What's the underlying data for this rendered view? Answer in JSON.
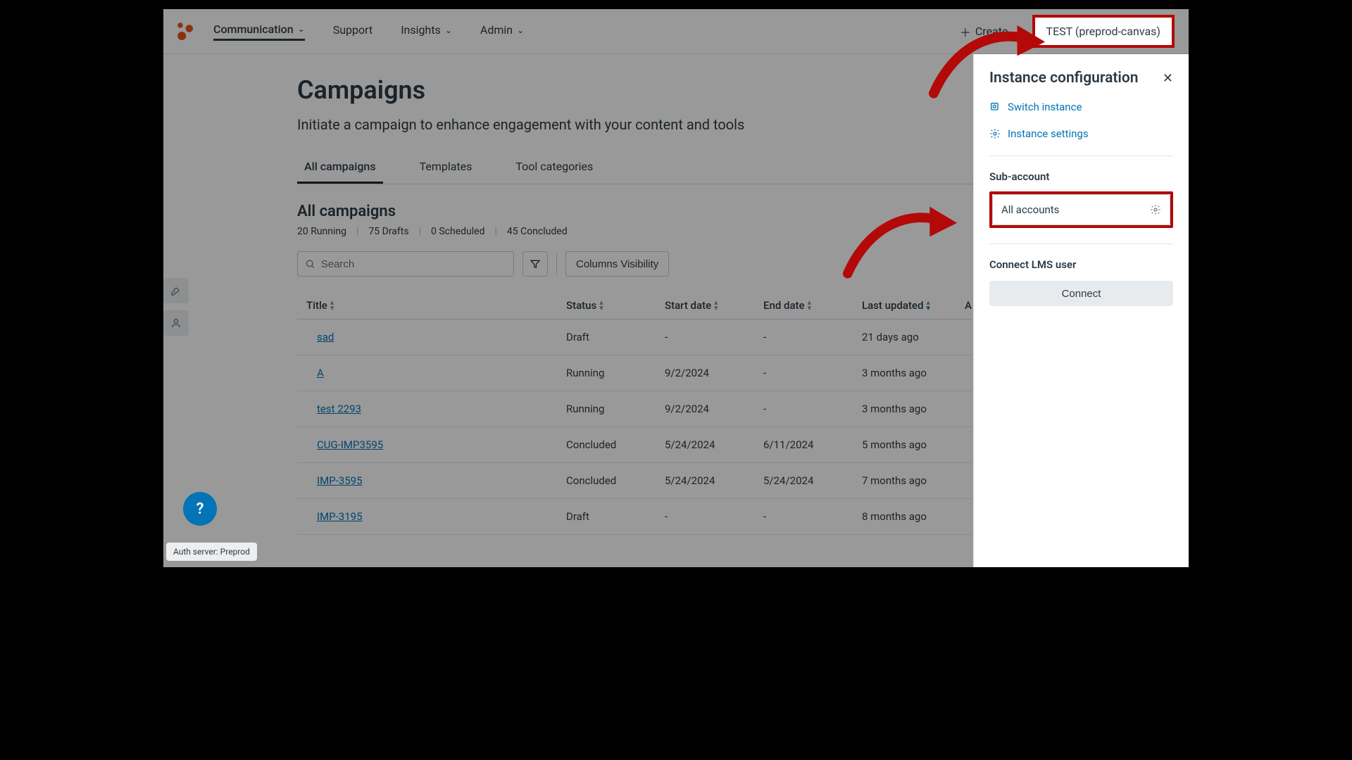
{
  "header": {
    "nav": {
      "communication": "Communication",
      "support": "Support",
      "insights": "Insights",
      "admin": "Admin"
    },
    "create": "Create",
    "instance": "TEST (preprod-canvas)"
  },
  "page": {
    "title": "Campaigns",
    "subtitle": "Initiate a campaign to enhance engagement with your content and tools"
  },
  "tabs": {
    "all": "All campaigns",
    "templates": "Templates",
    "toolcat": "Tool categories"
  },
  "section": {
    "heading": "All campaigns",
    "stats": {
      "running": "20 Running",
      "drafts": "75 Drafts",
      "scheduled": "0 Scheduled",
      "concluded": "45 Concluded"
    }
  },
  "toolbar": {
    "search_placeholder": "Search",
    "columns": "Columns Visibility"
  },
  "columns": {
    "title": "Title",
    "status": "Status",
    "start": "Start date",
    "end": "End date",
    "last": "Last updated",
    "a": "A"
  },
  "rows": [
    {
      "title": "sad",
      "status": "Draft",
      "start": "-",
      "end": "-",
      "last": "21 days ago"
    },
    {
      "title": "A",
      "status": "Running",
      "start": "9/2/2024",
      "end": "-",
      "last": "3 months ago"
    },
    {
      "title": "test 2293",
      "status": "Running",
      "start": "9/2/2024",
      "end": "-",
      "last": "3 months ago"
    },
    {
      "title": "CUG-IMP3595",
      "status": "Concluded",
      "start": "5/24/2024",
      "end": "6/11/2024",
      "last": "5 months ago"
    },
    {
      "title": "IMP-3595",
      "status": "Concluded",
      "start": "5/24/2024",
      "end": "5/24/2024",
      "last": "7 months ago"
    },
    {
      "title": "IMP-3195",
      "status": "Draft",
      "start": "-",
      "end": "-",
      "last": "8 months ago"
    }
  ],
  "panel": {
    "title": "Instance configuration",
    "switch": "Switch instance",
    "settings": "Instance settings",
    "subaccount_label": "Sub-account",
    "subaccount_value": "All accounts",
    "connect_label": "Connect LMS user",
    "connect_btn": "Connect"
  },
  "footer": {
    "help": "?",
    "auth": "Auth server: Preprod"
  }
}
